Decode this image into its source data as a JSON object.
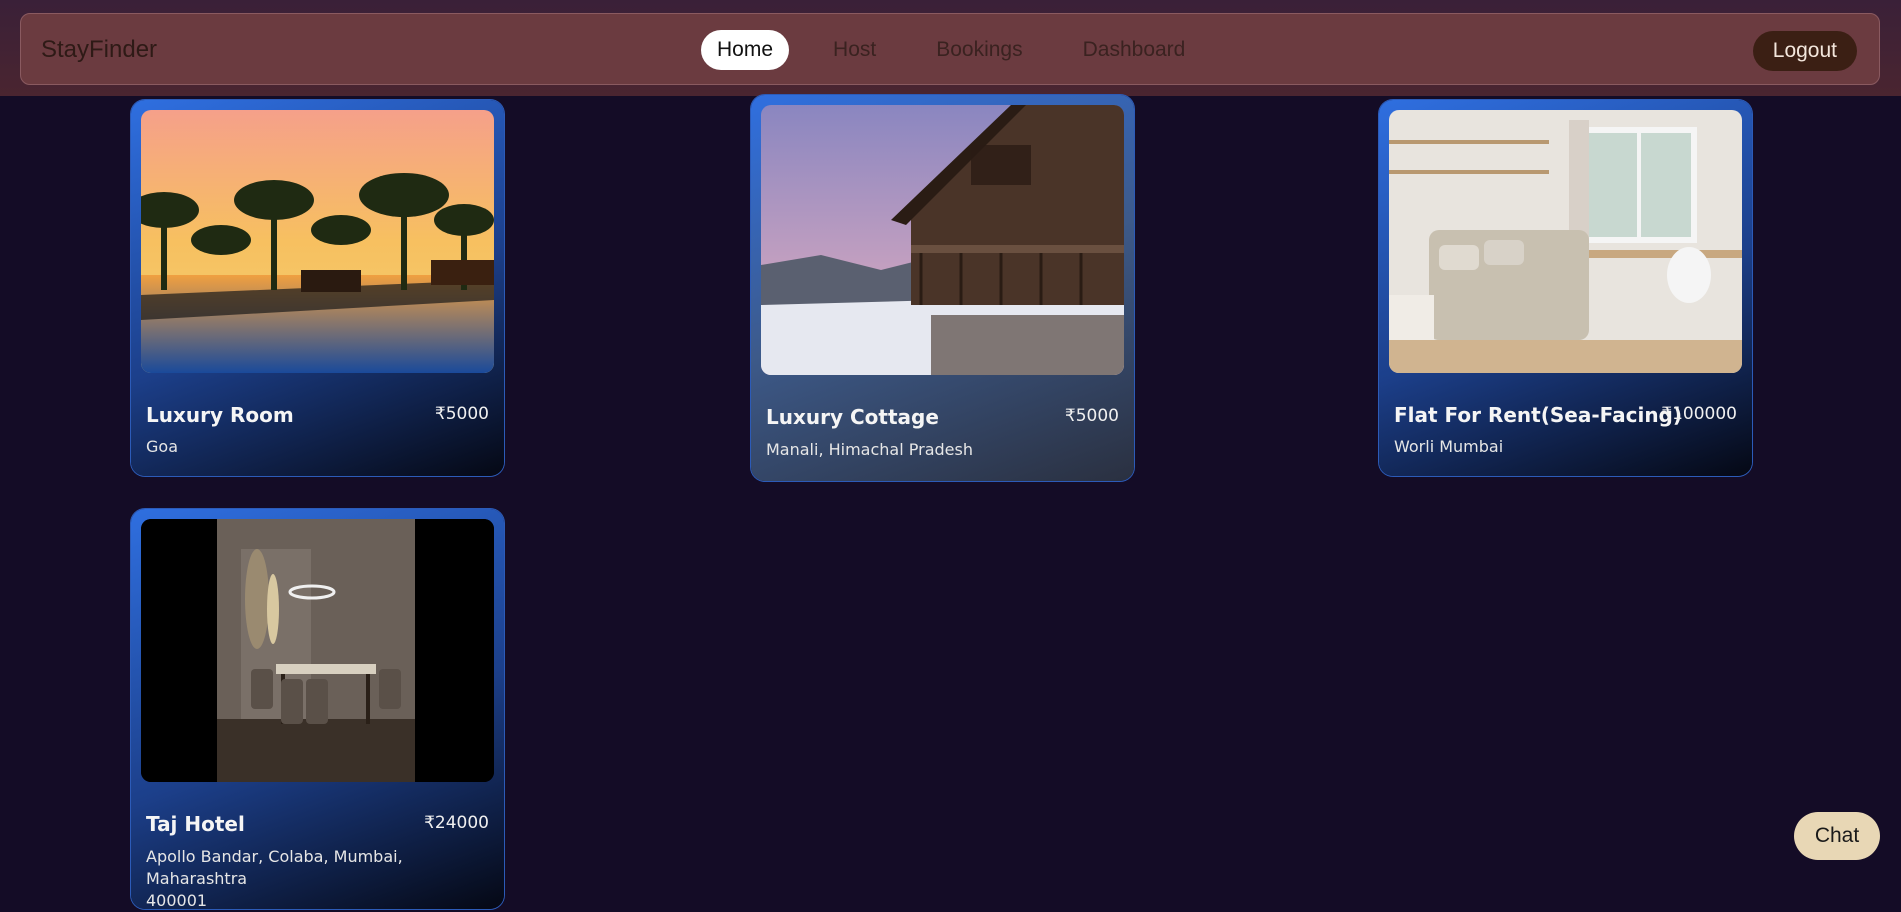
{
  "brand": "StayFinder",
  "nav": {
    "links": [
      {
        "label": "Home",
        "active": true
      },
      {
        "label": "Host"
      },
      {
        "label": "Bookings"
      },
      {
        "label": "Dashboard"
      }
    ],
    "logout_label": "Logout"
  },
  "listings": [
    {
      "title": "Luxury Room",
      "price": "₹5000",
      "location": "Goa",
      "image": "resort-pool-sunset"
    },
    {
      "title": "Luxury Cottage",
      "price": "₹5000",
      "location": "Manali, Himachal Pradesh",
      "image": "snow-chalet"
    },
    {
      "title": "Flat For Rent(Sea-Facing)",
      "price": "₹100000",
      "location": "Worli Mumbai",
      "image": "bedroom-interior"
    },
    {
      "title": "Taj Hotel",
      "price": "₹24000",
      "location": "Apollo Bandar, Colaba, Mumbai, Maharashtra",
      "location_cont": "400001",
      "image": "dining-room"
    }
  ],
  "chat_label": "Chat",
  "colors": {
    "background": "#140c26",
    "nav_bg": "#6b3b40",
    "card_blue": "#2f6fe0",
    "logout_bg": "#3b1f14",
    "chat_bg": "#e8d7b5"
  }
}
